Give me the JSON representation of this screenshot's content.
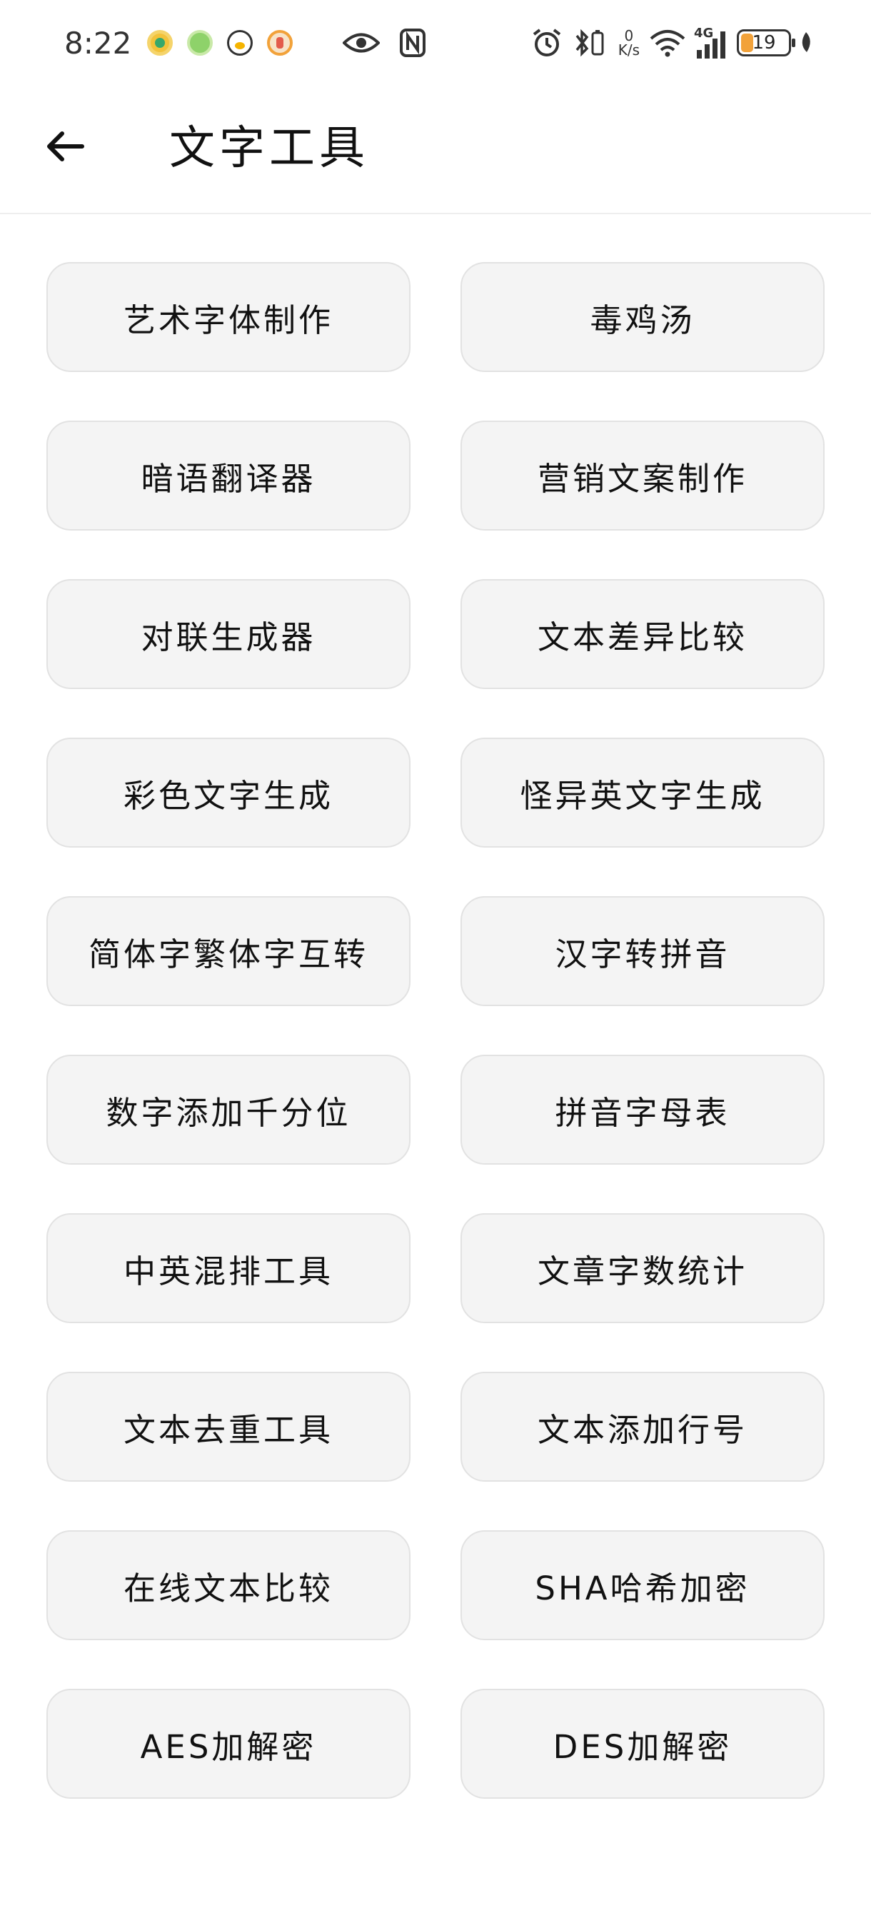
{
  "status_bar": {
    "time": "8:22",
    "net_speed_value": "0",
    "net_speed_unit": "K/s",
    "network_type": "4G",
    "battery_level": "19",
    "accent_battery": "#f2a23a"
  },
  "header": {
    "back_icon": "arrow-left-icon",
    "title": "文字工具"
  },
  "tools": [
    {
      "label": "艺术字体制作"
    },
    {
      "label": "毒鸡汤"
    },
    {
      "label": "暗语翻译器"
    },
    {
      "label": "营销文案制作"
    },
    {
      "label": "对联生成器"
    },
    {
      "label": "文本差异比较"
    },
    {
      "label": "彩色文字生成"
    },
    {
      "label": "怪异英文字生成"
    },
    {
      "label": "简体字繁体字互转"
    },
    {
      "label": "汉字转拼音"
    },
    {
      "label": "数字添加千分位"
    },
    {
      "label": "拼音字母表"
    },
    {
      "label": "中英混排工具"
    },
    {
      "label": "文章字数统计"
    },
    {
      "label": "文本去重工具"
    },
    {
      "label": "文本添加行号"
    },
    {
      "label": "在线文本比较"
    },
    {
      "label": "SHA哈希加密"
    },
    {
      "label": "AES加解密"
    },
    {
      "label": "DES加解密"
    }
  ],
  "colors": {
    "button_bg": "#f4f4f4",
    "button_border": "#e2e2e2",
    "text": "#111111"
  }
}
